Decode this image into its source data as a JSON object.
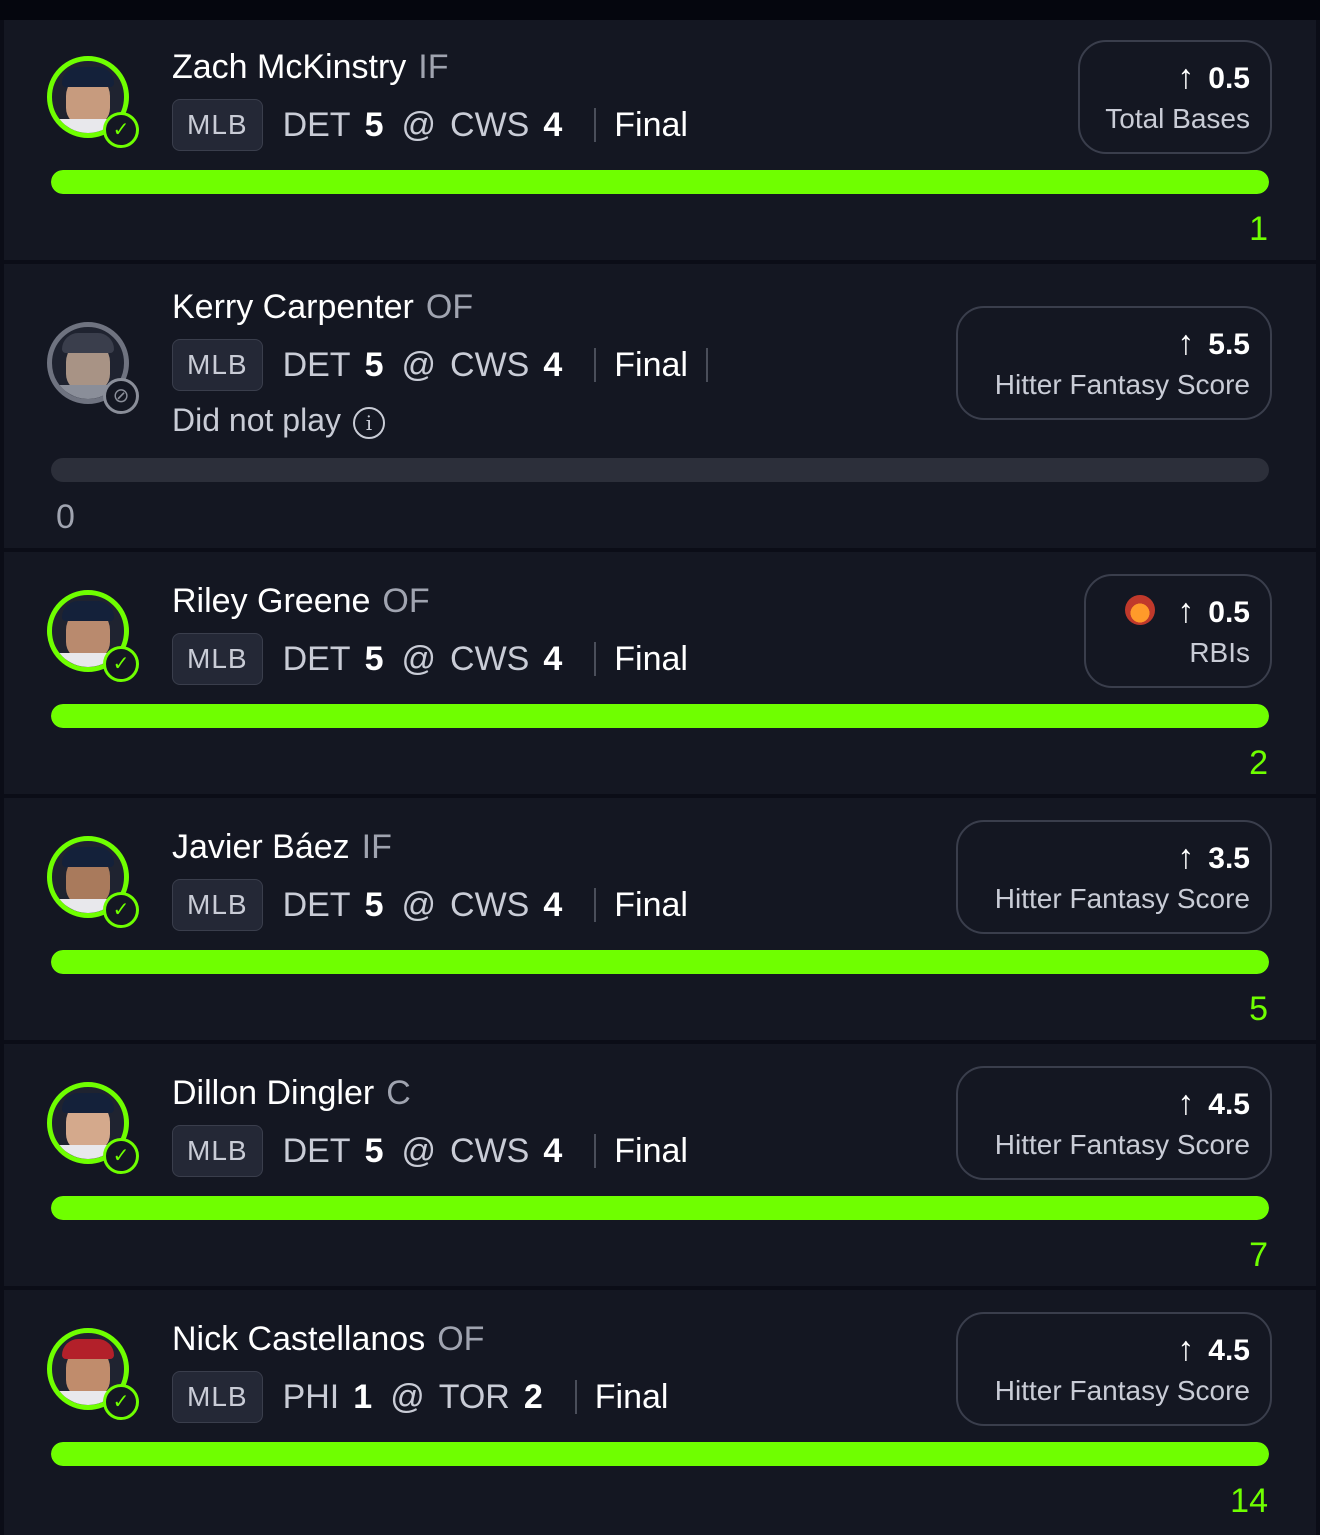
{
  "picks": [
    {
      "name": "Zach McKinstry",
      "position": "IF",
      "league": "MLB",
      "away_team": "DET",
      "away_score": "5",
      "at": "@",
      "home_team": "CWS",
      "home_score": "4",
      "status": "Final",
      "line": "0.5",
      "stat": "Total Bases",
      "result": "1",
      "progress": 1.0,
      "state": "hit"
    },
    {
      "name": "Kerry Carpenter",
      "position": "OF",
      "league": "MLB",
      "away_team": "DET",
      "away_score": "5",
      "at": "@",
      "home_team": "CWS",
      "home_score": "4",
      "status": "Final",
      "note": "Did not play",
      "line": "5.5",
      "stat": "Hitter Fantasy Score",
      "result": "0",
      "progress": 0.0,
      "state": "did-not-play"
    },
    {
      "name": "Riley Greene",
      "position": "OF",
      "league": "MLB",
      "away_team": "DET",
      "away_score": "5",
      "at": "@",
      "home_team": "CWS",
      "home_score": "4",
      "status": "Final",
      "line": "0.5",
      "stat": "RBIs",
      "result": "2",
      "progress": 1.0,
      "state": "hit"
    },
    {
      "name": "Javier Báez",
      "position": "IF",
      "league": "MLB",
      "away_team": "DET",
      "away_score": "5",
      "at": "@",
      "home_team": "CWS",
      "home_score": "4",
      "status": "Final",
      "line": "3.5",
      "stat": "Hitter Fantasy Score",
      "result": "5",
      "progress": 1.0,
      "state": "hit"
    },
    {
      "name": "Dillon Dingler",
      "position": "C",
      "league": "MLB",
      "away_team": "DET",
      "away_score": "5",
      "at": "@",
      "home_team": "CWS",
      "home_score": "4",
      "status": "Final",
      "line": "4.5",
      "stat": "Hitter Fantasy Score",
      "result": "7",
      "progress": 1.0,
      "state": "hit"
    },
    {
      "name": "Nick Castellanos",
      "position": "OF",
      "league": "MLB",
      "away_team": "PHI",
      "away_score": "1",
      "at": "@",
      "home_team": "TOR",
      "home_score": "2",
      "status": "Final",
      "line": "4.5",
      "stat": "Hitter Fantasy Score",
      "result": "14",
      "progress": 1.0,
      "state": "hit"
    }
  ],
  "icons": {
    "direction": "arrow-up-icon",
    "hit": "check-circle-icon",
    "dnp": "slash-circle-icon",
    "info": "info-icon",
    "special": "demon-icon"
  },
  "colors": {
    "accent": "#6fff00",
    "background": "#0b0d17",
    "card": "#141722"
  }
}
